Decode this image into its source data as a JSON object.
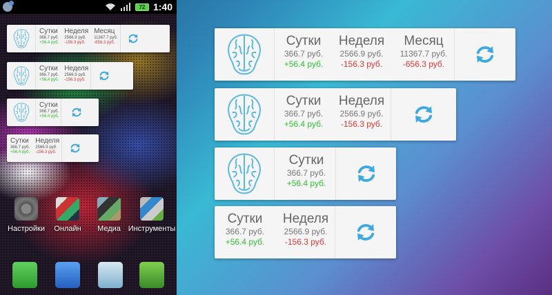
{
  "statusbar": {
    "battery": "72",
    "clock": "1:40"
  },
  "labels": {
    "day": "Сутки",
    "week": "Неделя",
    "month": "Месяц"
  },
  "values": {
    "day": {
      "value": "366.7 руб.",
      "delta": "+56.4 руб."
    },
    "week": {
      "value": "2566.9 руб.",
      "delta": "-156.3 руб."
    },
    "month": {
      "value": "11367.7 руб.",
      "delta": "-656.3 руб."
    }
  },
  "apps": [
    {
      "label": "Настройки"
    },
    {
      "label": "Онлайн"
    },
    {
      "label": "Медиа"
    },
    {
      "label": "Инструменты"
    }
  ],
  "colors": {
    "positive": "#2fc22f",
    "negative": "#e43535",
    "brain": "#5bb8e0",
    "refresh": "#3ea8e0"
  }
}
